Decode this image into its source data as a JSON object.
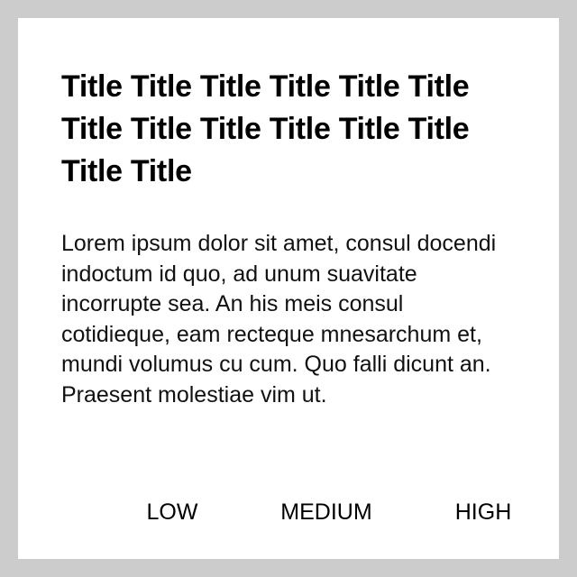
{
  "dialog": {
    "title": "Title Title Title Title Title Title Title Title Title Title Title Title Title Title",
    "body": "Lorem ipsum dolor sit amet, consul docendi indoctum id quo, ad unum suavitate incorrupte sea. An his meis consul cotidieque, eam recteque mnesarchum et, mundi volumus cu cum. Quo falli dicunt an. Praesent molestiae vim ut.",
    "actions": {
      "low": "LOW",
      "medium": "MEDIUM",
      "high": "HIGH"
    }
  },
  "colors": {
    "backdrop": "#cccccc",
    "surface": "#ffffff",
    "text": "#000000"
  }
}
